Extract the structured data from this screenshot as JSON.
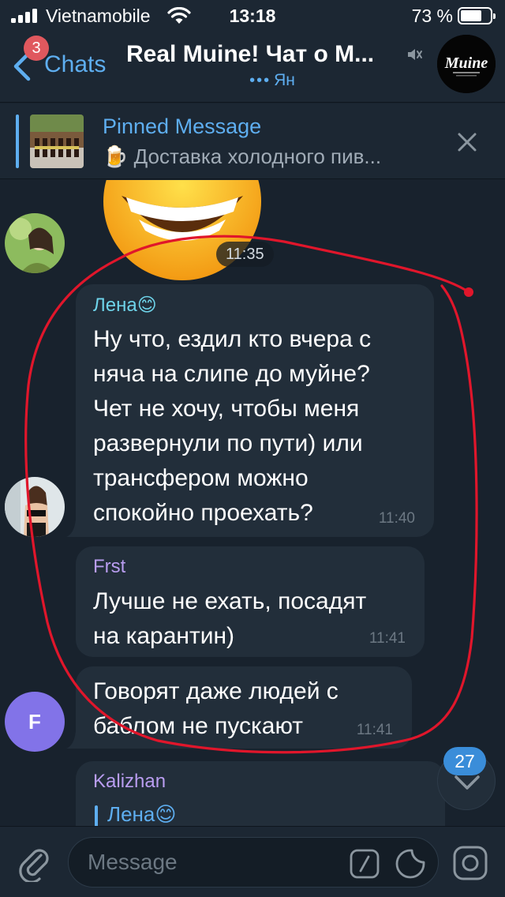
{
  "status_bar": {
    "carrier": "Vietnamobile",
    "time": "13:18",
    "battery_percent": "73 %",
    "battery_level": 0.73
  },
  "nav": {
    "back_label": "Chats",
    "unread_count": "3",
    "chat_title": "Real Muine! Чат о М...",
    "typing_user": "Ян"
  },
  "pinned": {
    "title": "Pinned Message",
    "text": "🍺 Доставка холодного пив..."
  },
  "messages": [
    {
      "sender": "Лена😊",
      "sender_color": "#6ed3e9",
      "lines": [
        "Ну что, ездил кто вчера с",
        "няча на слипе до муйне?",
        "Чет не хочу, чтобы меня",
        "развернули по пути) или",
        "трансфером можно",
        "спокойно проехать?"
      ],
      "time": "11:40"
    },
    {
      "sender": "Frst",
      "sender_color": "#b99df0",
      "lines": [
        "Лучше не ехать, посадят",
        "на карантин)"
      ],
      "time": "11:41"
    },
    {
      "lines": [
        "Говорят даже людей с",
        "баблом не пускают"
      ],
      "time": "11:41"
    },
    {
      "sender": "Kalizhan",
      "sender_color": "#b99df0",
      "reply_to": "Лена😊"
    }
  ],
  "sticker": {
    "time": "11:35"
  },
  "avatars": {
    "frst_initial": "F"
  },
  "scroll": {
    "unread_count": "27"
  },
  "input": {
    "placeholder": "Message"
  },
  "colors": {
    "accent": "#5eaef0",
    "annotation": "#e0162b",
    "bubble": "#222e3a",
    "background": "#18222d"
  }
}
